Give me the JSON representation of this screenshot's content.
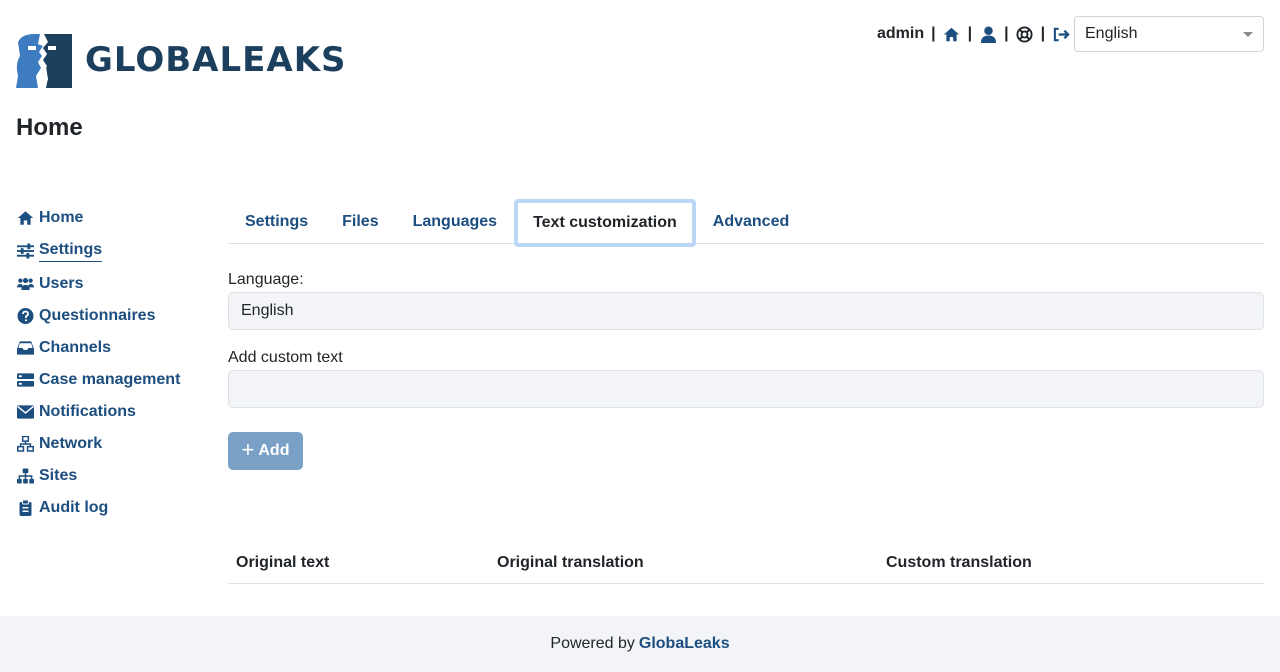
{
  "brand": {
    "name": "GLOBALEAKS"
  },
  "header": {
    "username": "admin",
    "separator": "|",
    "icons": [
      "home-icon",
      "user-icon",
      "support-icon",
      "logout-icon"
    ],
    "language": "English"
  },
  "page": {
    "title": "Home"
  },
  "sidebar": {
    "items": [
      {
        "label": "Home",
        "icon": "home-icon"
      },
      {
        "label": "Settings",
        "icon": "sliders-icon",
        "active": true
      },
      {
        "label": "Users",
        "icon": "users-icon"
      },
      {
        "label": "Questionnaires",
        "icon": "question-circle-icon"
      },
      {
        "label": "Channels",
        "icon": "inbox-icon"
      },
      {
        "label": "Case management",
        "icon": "server-icon"
      },
      {
        "label": "Notifications",
        "icon": "envelope-icon"
      },
      {
        "label": "Network",
        "icon": "network-icon"
      },
      {
        "label": "Sites",
        "icon": "sitemap-icon"
      },
      {
        "label": "Audit log",
        "icon": "clipboard-icon"
      }
    ]
  },
  "tabs": [
    {
      "label": "Settings"
    },
    {
      "label": "Files"
    },
    {
      "label": "Languages"
    },
    {
      "label": "Text customization",
      "active": true
    },
    {
      "label": "Advanced"
    }
  ],
  "form": {
    "language_label": "Language:",
    "language_value": "English",
    "custom_text_label": "Add custom text",
    "custom_text_value": "",
    "add_button": "Add"
  },
  "table": {
    "headers": [
      "Original text",
      "Original translation",
      "Custom translation"
    ]
  },
  "footer": {
    "prefix": "Powered by",
    "link": "GlobaLeaks"
  },
  "colors": {
    "brand": "#1c3f5e",
    "link": "#1c4e80",
    "button": "#7aa0c6",
    "tab_focus": "#bcd6f5"
  }
}
